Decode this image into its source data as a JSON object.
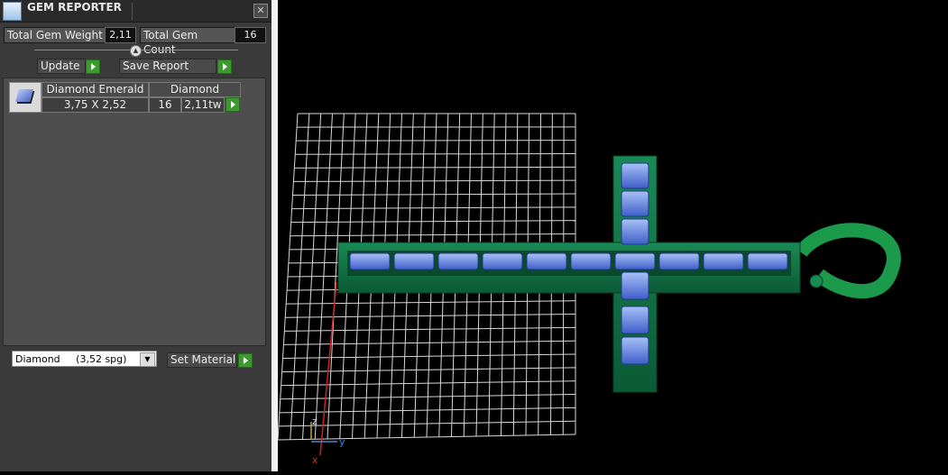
{
  "panel": {
    "title": "GEM REPORTER",
    "close_glyph": "✕",
    "total_weight_label": "Total Gem Weight",
    "total_weight_value": "2,11",
    "total_count_label": "Total Gem Count",
    "total_count_value": "16",
    "update_label": "Update",
    "save_report_label": "Save Report",
    "gem": {
      "shape": "Diamond Emerald",
      "material": "Diamond",
      "size": "3,75 X 2,52",
      "count": "16",
      "weight": "2,11tw"
    },
    "material_select": {
      "name": "Diamond",
      "density": "(3,52 spg)"
    },
    "set_material_label": "Set Material"
  },
  "viewport": {
    "axes": {
      "z": "z",
      "y": "y",
      "x": "x"
    }
  },
  "colors": {
    "accent_green": "#3c9a2f",
    "metal_green": "#0f6b3f",
    "gem_blue": "#5577dd"
  }
}
